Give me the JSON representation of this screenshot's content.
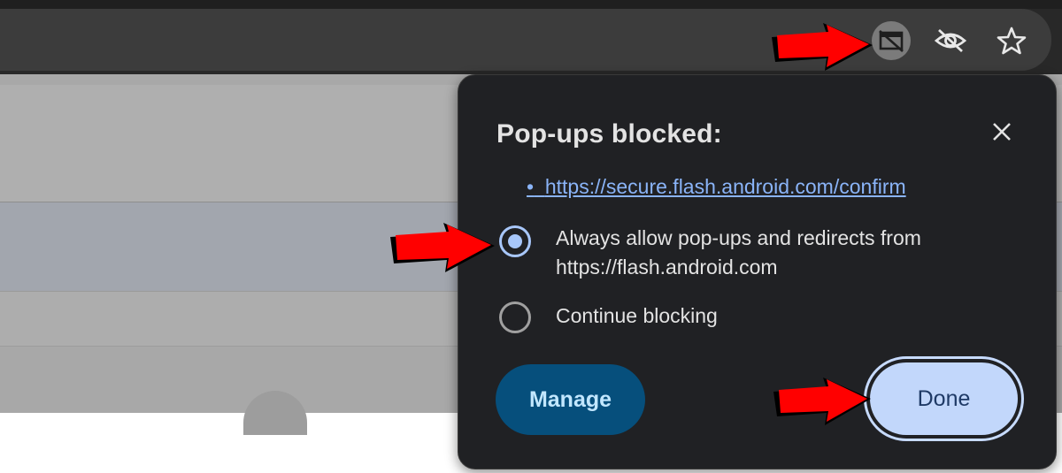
{
  "toolbar": {
    "icons": [
      "popup-blocked-icon",
      "eye-slash-icon",
      "star-icon"
    ]
  },
  "bubble": {
    "title": "Pop-ups blocked:",
    "close_icon": "close-icon",
    "bullet": "•",
    "blocked_url": "https://secure.flash.android.com/confirm",
    "options": [
      {
        "line1": "Always allow pop-ups and redirects from",
        "line2": "https://flash.android.com",
        "selected": true
      },
      {
        "line1": "Continue blocking",
        "selected": false
      }
    ],
    "manage_label": "Manage",
    "done_label": "Done"
  },
  "colors": {
    "bubble_bg": "#202124",
    "link": "#8ab4f8",
    "radio_selected": "#a8c7fa",
    "manage_bg": "#064f7c",
    "done_bg": "#c2d7fb",
    "annotation_arrow": "#ff0000"
  }
}
